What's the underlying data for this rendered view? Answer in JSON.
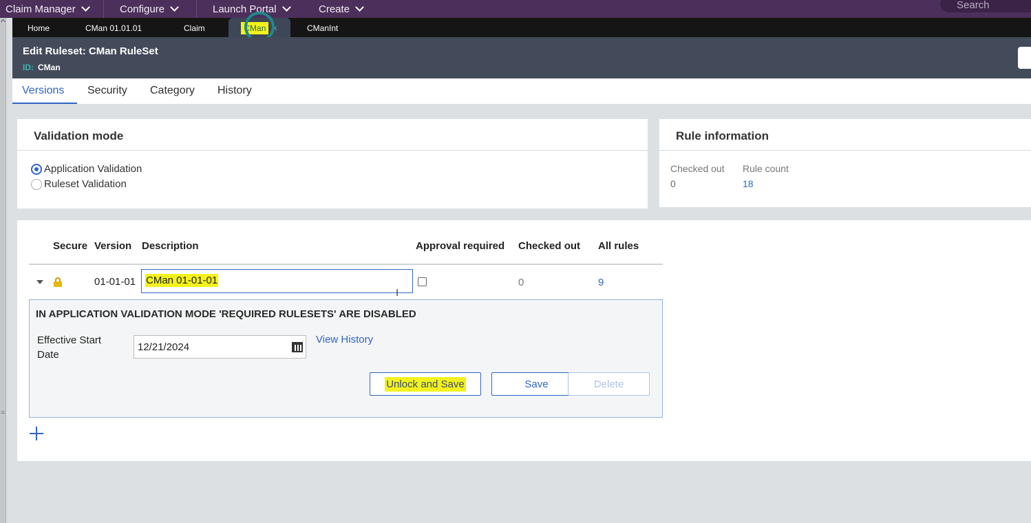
{
  "topnav": {
    "items": [
      {
        "label": "Claim Manager"
      },
      {
        "label": "Configure"
      },
      {
        "label": "Launch Portal"
      },
      {
        "label": "Create"
      }
    ],
    "search_placeholder": "Search"
  },
  "tabs": [
    {
      "label": "Home"
    },
    {
      "label": "CMan 01.01.01"
    },
    {
      "label": "Claim"
    },
    {
      "label": "CMan",
      "active": true
    },
    {
      "label": "CManInt"
    }
  ],
  "header": {
    "title_prefix": "Edit",
    "title": "Ruleset: CMan RuleSet",
    "id_label": "ID:",
    "id_value": "CMan"
  },
  "subtabs": [
    "Versions",
    "Security",
    "Category",
    "History"
  ],
  "validation": {
    "title": "Validation mode",
    "options": [
      {
        "label": "Application Validation",
        "selected": true
      },
      {
        "label": "Ruleset Validation",
        "selected": false
      }
    ]
  },
  "rule_info": {
    "title": "Rule information",
    "checked_out_label": "Checked out",
    "checked_out_value": "0",
    "rule_count_label": "Rule count",
    "rule_count_value": "18"
  },
  "versions_table": {
    "columns": [
      "Secure",
      "Version",
      "Description",
      "Approval required",
      "Checked out",
      "All rules"
    ],
    "rows": [
      {
        "version": "01-01-01",
        "description": "CMan 01-01-01",
        "approval_required": false,
        "checked_out": "0",
        "all_rules": "9"
      }
    ]
  },
  "details": {
    "warning": "IN APPLICATION VALIDATION MODE 'REQUIRED RULESETS' ARE DISABLED",
    "effective_start_label": "Effective Start Date",
    "effective_start_value": "12/21/2024",
    "view_history": "View History",
    "unlock_save": "Unlock and Save",
    "save": "Save",
    "delete": "Delete"
  },
  "colors": {
    "nav_bg": "#4c2f5b",
    "header_bg": "#434b5a",
    "accent": "#2f64c5",
    "highlight": "#f3f21b"
  }
}
